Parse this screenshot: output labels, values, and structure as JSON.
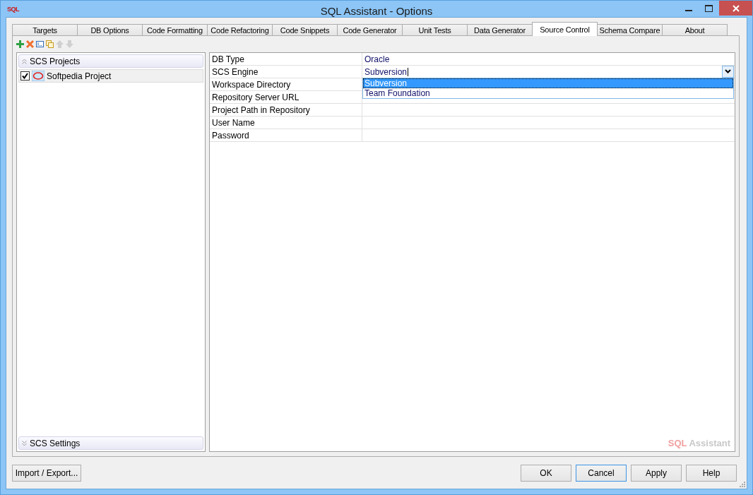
{
  "window": {
    "app_icon": "SQL",
    "title": "SQL Assistant - Options"
  },
  "tabs": [
    {
      "label": "Targets",
      "selected": false
    },
    {
      "label": "DB Options",
      "selected": false
    },
    {
      "label": "Code Formatting",
      "selected": false
    },
    {
      "label": "Code Refactoring",
      "selected": false
    },
    {
      "label": "Code Snippets",
      "selected": false
    },
    {
      "label": "Code Generator",
      "selected": false
    },
    {
      "label": "Unit Tests",
      "selected": false
    },
    {
      "label": "Data Generator",
      "selected": false
    },
    {
      "label": "Source Control",
      "selected": true
    },
    {
      "label": "Schema Compare",
      "selected": false
    },
    {
      "label": "About",
      "selected": false
    }
  ],
  "toolbar": [
    {
      "kind": "add",
      "disabled": false
    },
    {
      "kind": "delete",
      "disabled": false
    },
    {
      "kind": "rename",
      "disabled": false
    },
    {
      "kind": "copy",
      "disabled": false
    },
    {
      "kind": "up",
      "disabled": true
    },
    {
      "kind": "down",
      "disabled": true
    }
  ],
  "projects_panel": {
    "header": "SCS Projects",
    "items": [
      {
        "label": "Softpedia Project",
        "checked": true,
        "selected": true
      }
    ],
    "footer": "SCS Settings"
  },
  "properties": [
    {
      "name": "DB Type",
      "value": "Oracle",
      "kind": "text"
    },
    {
      "name": "SCS Engine",
      "value": "Subversion",
      "kind": "combo"
    },
    {
      "name": "Workspace Directory",
      "kind": "text"
    },
    {
      "name": "Repository Server URL",
      "kind": "text"
    },
    {
      "name": "Project Path in Repository",
      "kind": "text"
    },
    {
      "name": "User Name",
      "kind": "text"
    },
    {
      "name": "Password",
      "kind": "text"
    }
  ],
  "dropdown": {
    "options": [
      {
        "label": "Subversion",
        "selected": true
      },
      {
        "label": "Team Foundation",
        "selected": false
      }
    ]
  },
  "brand": {
    "part_1": "SQL",
    "part_2": "Assistant"
  },
  "buttons": {
    "left": "Import / Export...",
    "right": [
      {
        "label": "OK",
        "focused": false
      },
      {
        "label": "Cancel",
        "focused": true
      },
      {
        "label": "Apply",
        "focused": false
      },
      {
        "label": "Help",
        "focused": false
      }
    ]
  }
}
